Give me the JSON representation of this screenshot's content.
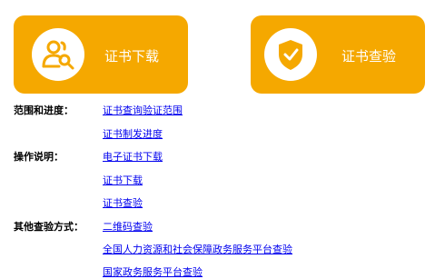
{
  "tiles": {
    "download": {
      "label": "证书下载",
      "icon": "person-search-icon"
    },
    "verify": {
      "label": "证书查验",
      "icon": "shield-check-icon"
    }
  },
  "sections": {
    "scope": {
      "label": "范围和进度：",
      "links": [
        "证书查询验证范围",
        "证书制发进度"
      ]
    },
    "guide": {
      "label": "操作说明：",
      "links": [
        "电子证书下载",
        "证书下载",
        "证书查验"
      ]
    },
    "other": {
      "label": "其他查验方式：",
      "links": [
        "二维码查验",
        "全国人力资源和社会保障政务服务平台查验",
        "国家政务服务平台查验"
      ]
    }
  },
  "colors": {
    "accent": "#f5a800",
    "link": "#0000ee"
  }
}
